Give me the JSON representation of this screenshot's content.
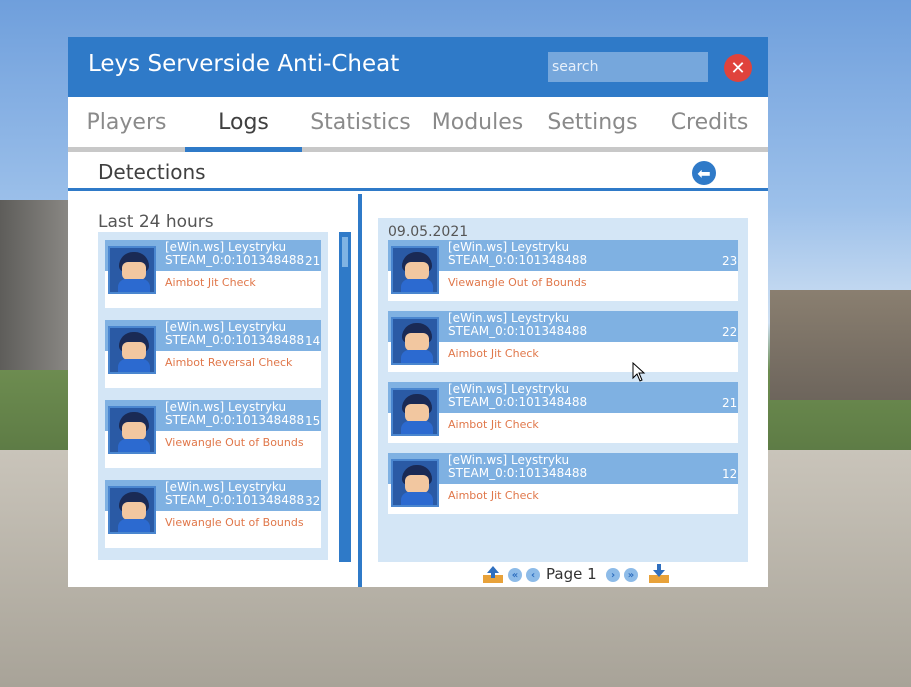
{
  "window": {
    "title": "Leys Serverside Anti-Cheat"
  },
  "search": {
    "placeholder": "search"
  },
  "tabs": [
    {
      "label": "Players"
    },
    {
      "label": "Logs"
    },
    {
      "label": "Statistics"
    },
    {
      "label": "Modules"
    },
    {
      "label": "Settings"
    },
    {
      "label": "Credits"
    }
  ],
  "active_tab": "Logs",
  "section": {
    "title": "Detections"
  },
  "left_panel": {
    "caption": "Last 24 hours",
    "entries": [
      {
        "name": "[eWin.ws] Leystryku",
        "steam_id": "STEAM_0:0:101348488",
        "count": "21",
        "check": "Aimbot Jit Check"
      },
      {
        "name": "[eWin.ws] Leystryku",
        "steam_id": "STEAM_0:0:101348488",
        "count": "14",
        "check": "Aimbot Reversal Check"
      },
      {
        "name": "[eWin.ws] Leystryku",
        "steam_id": "STEAM_0:0:101348488",
        "count": "15",
        "check": "Viewangle Out of Bounds"
      },
      {
        "name": "[eWin.ws] Leystryku",
        "steam_id": "STEAM_0:0:101348488",
        "count": "32",
        "check": "Viewangle Out of Bounds"
      }
    ]
  },
  "right_panel": {
    "date": "09.05.2021",
    "entries": [
      {
        "name": "[eWin.ws] Leystryku",
        "steam_id": "STEAM_0:0:101348488",
        "count": "23",
        "check": "Viewangle Out of Bounds"
      },
      {
        "name": "[eWin.ws] Leystryku",
        "steam_id": "STEAM_0:0:101348488",
        "count": "22",
        "check": "Aimbot Jit Check"
      },
      {
        "name": "[eWin.ws] Leystryku",
        "steam_id": "STEAM_0:0:101348488",
        "count": "21",
        "check": "Aimbot Jit Check"
      },
      {
        "name": "[eWin.ws] Leystryku",
        "steam_id": "STEAM_0:0:101348488",
        "count": "12",
        "check": "Aimbot Jit Check"
      }
    ]
  },
  "pager": {
    "label": "Page 1"
  },
  "colors": {
    "accent": "#2f7ac8",
    "close": "#e0433c",
    "check_text": "#e0774a",
    "panel_bg": "#d4e6f6"
  },
  "icons": [
    "close-icon",
    "back-arrow-icon",
    "upload-icon",
    "first-page-icon",
    "prev-page-icon",
    "next-page-icon",
    "last-page-icon",
    "download-icon"
  ]
}
